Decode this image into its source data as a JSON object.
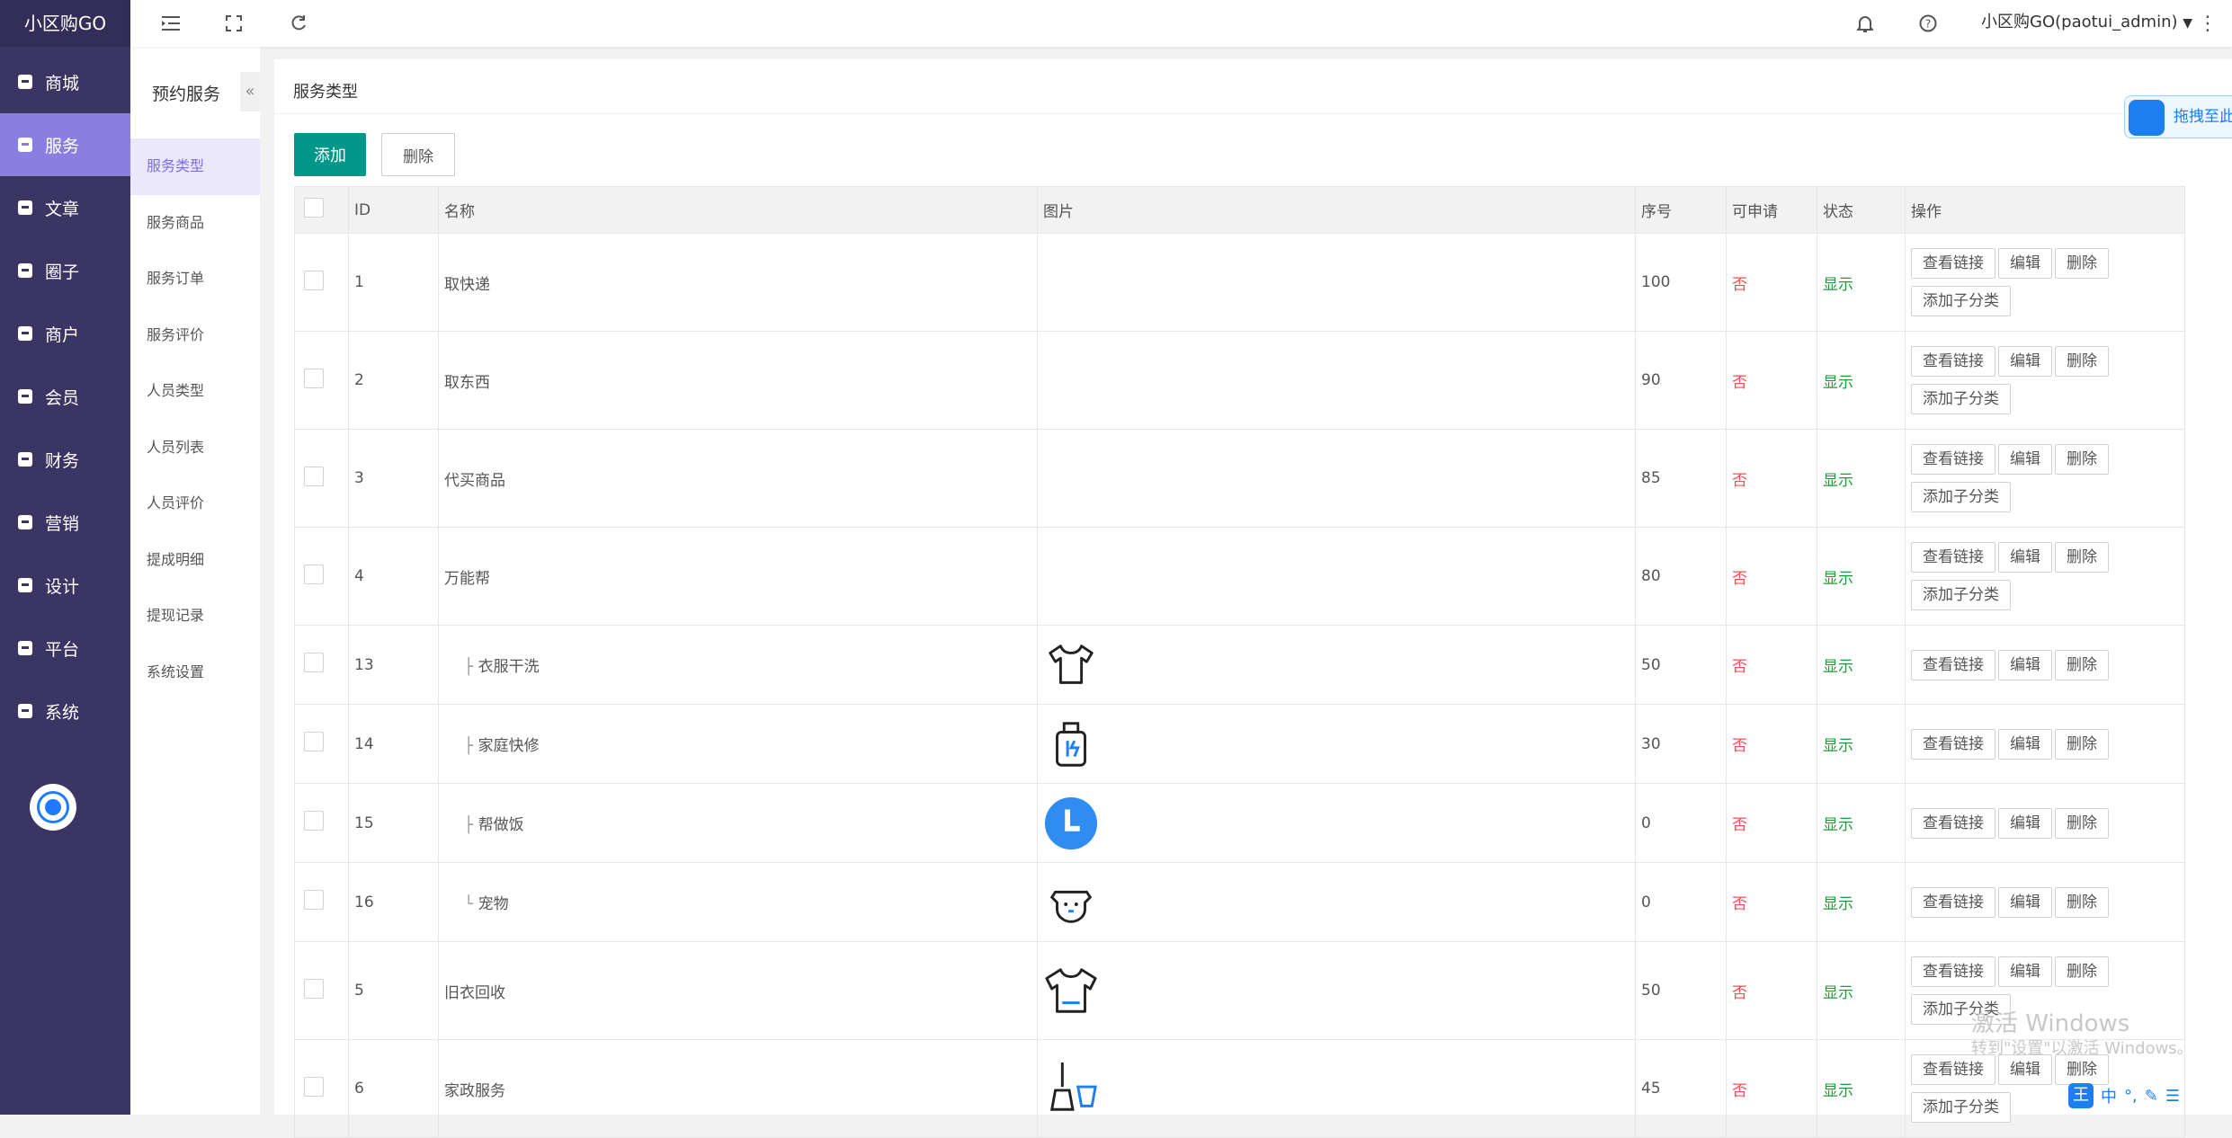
{
  "app": {
    "title": "小区购GO",
    "user": "小区购GO(paotui_admin)"
  },
  "sidebar": {
    "items": [
      {
        "label": "商城",
        "icon": "shop-icon"
      },
      {
        "label": "服务",
        "icon": "service-icon"
      },
      {
        "label": "文章",
        "icon": "article-icon"
      },
      {
        "label": "圈子",
        "icon": "circle-icon"
      },
      {
        "label": "商户",
        "icon": "merchant-icon"
      },
      {
        "label": "会员",
        "icon": "member-icon"
      },
      {
        "label": "财务",
        "icon": "finance-icon"
      },
      {
        "label": "营销",
        "icon": "marketing-icon"
      },
      {
        "label": "设计",
        "icon": "design-icon"
      },
      {
        "label": "平台",
        "icon": "platform-icon"
      },
      {
        "label": "系统",
        "icon": "system-icon"
      }
    ],
    "active": "服务"
  },
  "submenu": {
    "title": "预约服务",
    "collapse": "«",
    "items": [
      "服务类型",
      "服务商品",
      "服务订单",
      "服务评价",
      "人员类型",
      "人员列表",
      "人员评价",
      "提成明细",
      "提现记录",
      "系统设置"
    ],
    "active": "服务类型"
  },
  "page": {
    "title": "服务类型",
    "add_label": "添加",
    "delete_label": "删除"
  },
  "table": {
    "headers": [
      "ID",
      "名称",
      "图片",
      "序号",
      "可申请",
      "状态",
      "操作"
    ],
    "actions": {
      "view": "查看链接",
      "edit": "编辑",
      "delete": "删除",
      "add_child": "添加子分类"
    },
    "rows": [
      {
        "id": "1",
        "name": "取快递",
        "prefix": "",
        "sort": "100",
        "apply": "否",
        "status": "显示",
        "image": "",
        "child": true
      },
      {
        "id": "2",
        "name": "取东西",
        "prefix": "",
        "sort": "90",
        "apply": "否",
        "status": "显示",
        "image": "",
        "child": true
      },
      {
        "id": "3",
        "name": "代买商品",
        "prefix": "",
        "sort": "85",
        "apply": "否",
        "status": "显示",
        "image": "",
        "child": true
      },
      {
        "id": "4",
        "name": "万能帮",
        "prefix": "",
        "sort": "80",
        "apply": "否",
        "status": "显示",
        "image": "",
        "child": true
      },
      {
        "id": "13",
        "name": "衣服干洗",
        "prefix": "├",
        "sort": "50",
        "apply": "否",
        "status": "显示",
        "image": "shirt-icon",
        "child": false
      },
      {
        "id": "14",
        "name": "家庭快修",
        "prefix": "├",
        "sort": "30",
        "apply": "否",
        "status": "显示",
        "image": "toolbox-icon",
        "child": false
      },
      {
        "id": "15",
        "name": "帮做饭",
        "prefix": "├",
        "sort": "0",
        "apply": "否",
        "status": "显示",
        "image": "clock-icon",
        "child": false
      },
      {
        "id": "16",
        "name": "宠物",
        "prefix": "└",
        "sort": "0",
        "apply": "否",
        "status": "显示",
        "image": "dog-icon",
        "child": false
      },
      {
        "id": "5",
        "name": "旧衣回收",
        "prefix": "",
        "sort": "50",
        "apply": "否",
        "status": "显示",
        "image": "tshirt-icon",
        "child": true
      },
      {
        "id": "6",
        "name": "家政服务",
        "prefix": "",
        "sort": "45",
        "apply": "否",
        "status": "显示",
        "image": "broom-icon",
        "child": true
      }
    ]
  },
  "overlay": {
    "drag_label": "拖拽至此",
    "watermark_title": "激活 Windows",
    "watermark_sub": "转到\"设置\"以激活 Windows。",
    "ime": [
      "王",
      "中",
      "°,",
      "✎",
      "☰"
    ]
  },
  "colors": {
    "sidebar": "#3b3564",
    "sidebar_active": "#8a7fe0",
    "submenu_active": "#ebe8fb",
    "primary": "#009688",
    "no": "#ff4d4f",
    "yes": "#1a9c36"
  }
}
